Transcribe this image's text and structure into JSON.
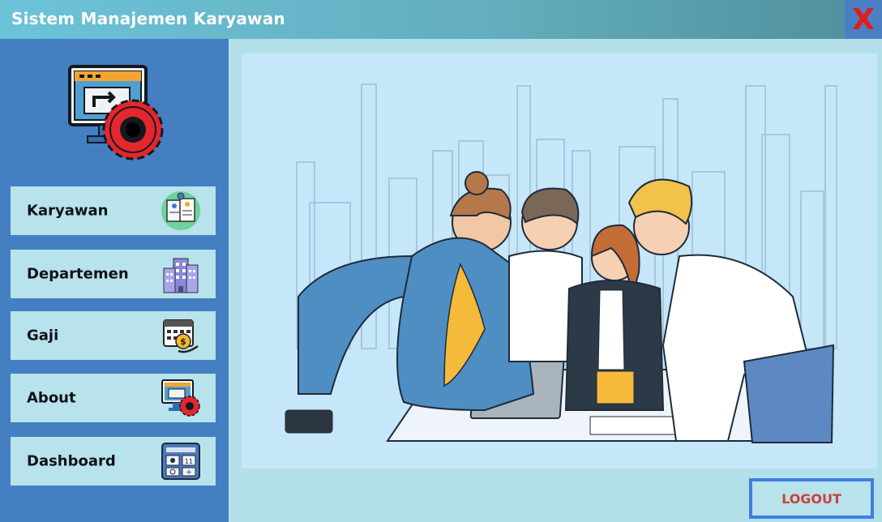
{
  "window": {
    "title": "Sistem Manajemen Karyawan",
    "close_label": "X"
  },
  "sidebar": {
    "logo_icon": "monitor-gear-icon",
    "items": [
      {
        "label": "Karyawan",
        "icon": "employee-documents-icon"
      },
      {
        "label": "Departemen",
        "icon": "building-icon"
      },
      {
        "label": "Gaji",
        "icon": "salary-calendar-icon"
      },
      {
        "label": "About",
        "icon": "monitor-gear-icon"
      },
      {
        "label": "Dashboard",
        "icon": "dashboard-calculator-icon"
      }
    ]
  },
  "main": {
    "illustration": "team-meeting-illustration"
  },
  "logout_label": "LOGOUT",
  "colors": {
    "sidebar": "#447fc1",
    "panel": "#c6e6fa",
    "background": "#b3e0e8",
    "close": "#e31b1b",
    "logout_text": "#c9403b",
    "logout_border": "#3f7de0"
  }
}
